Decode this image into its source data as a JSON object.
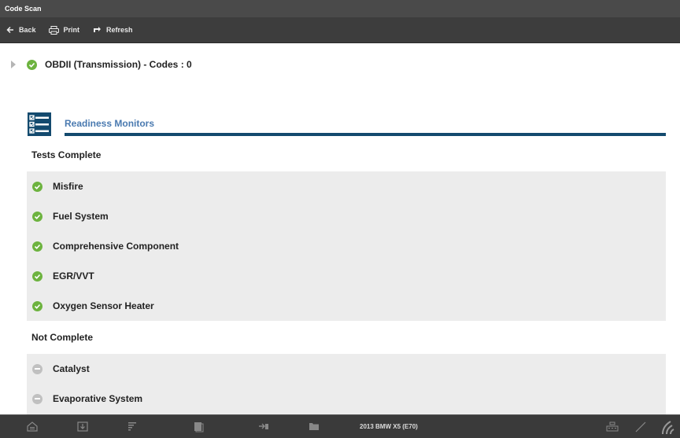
{
  "window": {
    "title": "Code Scan"
  },
  "toolbar": {
    "back_label": "Back",
    "print_label": "Print",
    "refresh_label": "Refresh"
  },
  "module": {
    "label": "OBDII (Transmission) -  Codes : 0"
  },
  "section": {
    "title": "Readiness Monitors"
  },
  "complete": {
    "label": "Tests Complete",
    "items": [
      {
        "label": "Misfire"
      },
      {
        "label": "Fuel System"
      },
      {
        "label": "Comprehensive Component"
      },
      {
        "label": "EGR/VVT"
      },
      {
        "label": "Oxygen Sensor Heater"
      }
    ]
  },
  "not_complete": {
    "label": "Not Complete",
    "items": [
      {
        "label": "Catalyst"
      },
      {
        "label": "Evaporative System"
      }
    ]
  },
  "bottom": {
    "vehicle": "2013 BMW X5 (E70)"
  },
  "colors": {
    "complete": "#6db33f",
    "incomplete": "#c0c0c0",
    "accent": "#134a6e",
    "title": "#4a7ab0"
  }
}
